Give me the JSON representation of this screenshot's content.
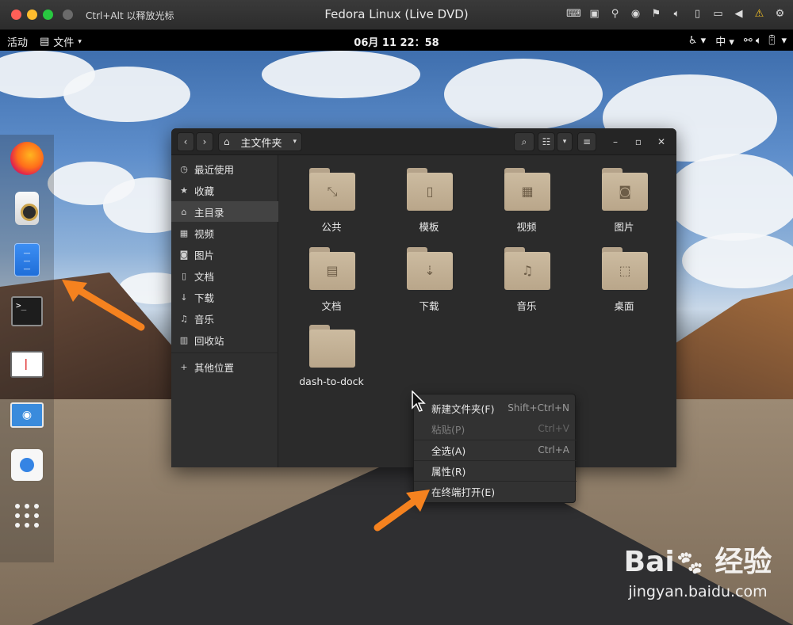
{
  "host": {
    "hint": "Ctrl+Alt 以释放光标",
    "title": "Fedora Linux (Live DVD)"
  },
  "gnome": {
    "activities": "活动",
    "app_menu": "文件",
    "clock": "06月 11 22：58",
    "input_method": "中"
  },
  "window": {
    "path": "主文件夹",
    "sidebar": [
      {
        "icon": "recent-icon",
        "label": "最近使用"
      },
      {
        "icon": "star-icon",
        "label": "收藏"
      },
      {
        "icon": "home-icon",
        "label": "主目录",
        "active": true
      },
      {
        "icon": "video-icon",
        "label": "视频"
      },
      {
        "icon": "camera-icon",
        "label": "图片"
      },
      {
        "icon": "document-icon",
        "label": "文档"
      },
      {
        "icon": "download-icon",
        "label": "下载"
      },
      {
        "icon": "music-icon",
        "label": "音乐"
      },
      {
        "icon": "trash-icon",
        "label": "回收站"
      },
      {
        "icon": "plus-icon",
        "label": "其他位置"
      }
    ],
    "folders": [
      {
        "label": "公共",
        "icon": "share-folder-icon"
      },
      {
        "label": "模板",
        "icon": "template-folder-icon"
      },
      {
        "label": "视频",
        "icon": "video-folder-icon"
      },
      {
        "label": "图片",
        "icon": "pictures-folder-icon"
      },
      {
        "label": "文档",
        "icon": "documents-folder-icon"
      },
      {
        "label": "下载",
        "icon": "download-folder-icon"
      },
      {
        "label": "音乐",
        "icon": "music-folder-icon"
      },
      {
        "label": "桌面",
        "icon": "desktop-folder-icon"
      },
      {
        "label": "dash-to-dock",
        "icon": "folder-icon"
      }
    ]
  },
  "context_menu": [
    {
      "label": "新建文件夹(F)",
      "shortcut": "Shift+Ctrl+N",
      "disabled": false
    },
    {
      "label": "粘贴(P)",
      "shortcut": "Ctrl+V",
      "disabled": true
    },
    {
      "label": "全选(A)",
      "shortcut": "Ctrl+A",
      "disabled": false
    },
    {
      "label": "属性(R)",
      "shortcut": "",
      "disabled": false
    },
    {
      "label": "在终端打开(E)",
      "shortcut": "",
      "disabled": false
    }
  ],
  "watermark": {
    "logo": "Bai du 经验",
    "url": "jingyan.baidu.com"
  },
  "colors": {
    "annotation_arrow": "#f5821f",
    "folder": "#c7b698",
    "headerbar": "#252525"
  }
}
